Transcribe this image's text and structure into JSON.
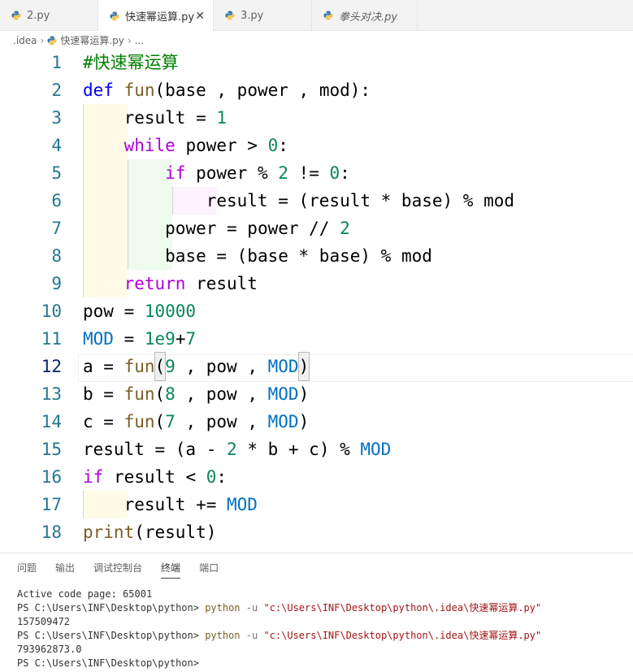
{
  "tabs": [
    {
      "label": "2.py",
      "active": false,
      "italic": false
    },
    {
      "label": "快速幂运算.py",
      "active": true,
      "italic": false,
      "close": "✕"
    },
    {
      "label": "3.py",
      "active": false,
      "italic": false
    },
    {
      "label": "拳头对决.py",
      "active": false,
      "italic": true
    }
  ],
  "breadcrumb": {
    "folder": ".idea",
    "file": "快速幂运算.py",
    "more": "..."
  },
  "colors": {
    "keyword": "#0000ff",
    "control": "#af00db",
    "function": "#795e26",
    "number": "#098658",
    "constant": "#0070c1",
    "comment": "#008000",
    "line_number": "#237893"
  },
  "editor": {
    "current_line": 12,
    "lines": [
      {
        "n": "1"
      },
      {
        "n": "2"
      },
      {
        "n": "3"
      },
      {
        "n": "4"
      },
      {
        "n": "5"
      },
      {
        "n": "6"
      },
      {
        "n": "7"
      },
      {
        "n": "8"
      },
      {
        "n": "9"
      },
      {
        "n": "10"
      },
      {
        "n": "11"
      },
      {
        "n": "12"
      },
      {
        "n": "13"
      },
      {
        "n": "14"
      },
      {
        "n": "15"
      },
      {
        "n": "16"
      },
      {
        "n": "17"
      },
      {
        "n": "18"
      }
    ],
    "tokens": {
      "l1_comment": "#快速幂运算",
      "l2_def": "def",
      "l2_fun": "fun",
      "l2_sig": "(base , power , mod):",
      "l3_result": "result = ",
      "l3_one": "1",
      "l4_while": "while",
      "l4_cond": " power > ",
      "l4_zero": "0",
      "l4_colon": ":",
      "l5_if": "if",
      "l5_a": " power % ",
      "l5_two": "2",
      "l5_b": " != ",
      "l5_zero": "0",
      "l5_colon": ":",
      "l6_code": "result = (result * base) % mod",
      "l7_a": "power = power // ",
      "l7_two": "2",
      "l8_code": "base = (base * base) % mod",
      "l9_return": "return",
      "l9_rest": " result",
      "l10_a": "pow = ",
      "l10_num": "10000",
      "l11_mod": "MOD",
      "l11_eq": " = ",
      "l11_num1": "1e9",
      "l11_plus": "+",
      "l11_num2": "7",
      "l12_a": "a = ",
      "l12_fun": "fun",
      "l12_open": "(",
      "l12_num": "9",
      "l12_mid": " , pow , ",
      "l12_mod": "MOD",
      "l12_close": ")",
      "l13_a": "b = ",
      "l13_fun": "fun",
      "l13_open": "(",
      "l13_num": "8",
      "l13_mid": " , pow , ",
      "l13_mod": "MOD",
      "l13_close": ")",
      "l14_a": "c = ",
      "l14_fun": "fun",
      "l14_open": "(",
      "l14_num": "7",
      "l14_mid": " , pow , ",
      "l14_mod": "MOD",
      "l14_close": ")",
      "l15_a": "result = (a - ",
      "l15_num": "2",
      "l15_b": " * b + c) % ",
      "l15_mod": "MOD",
      "l16_if": "if",
      "l16_a": " result < ",
      "l16_zero": "0",
      "l16_colon": ":",
      "l17_a": "result += ",
      "l17_mod": "MOD",
      "l18_print": "print",
      "l18_rest": "(result)"
    }
  },
  "panel": {
    "tabs": [
      "问题",
      "输出",
      "调试控制台",
      "终端",
      "端口"
    ],
    "active_tab": "终端",
    "terminal": {
      "l1": "Active code page: 65001",
      "prompt": "PS C:\\Users\\INF\\Desktop\\python> ",
      "cmd": "python",
      "flag": " -u ",
      "path": "\"c:\\Users\\INF\\Desktop\\python\\.idea\\快速幂运算.py\"",
      "out1": "157509472",
      "out2": "793962873.0",
      "last_prompt": "PS C:\\Users\\INF\\Desktop\\python>"
    }
  }
}
